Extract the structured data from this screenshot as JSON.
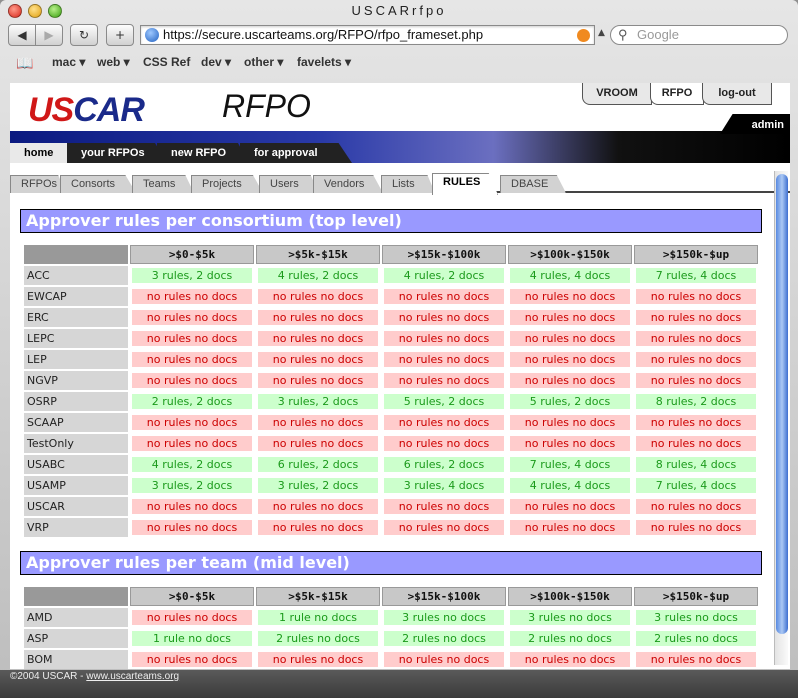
{
  "window": {
    "title": "USCARrfpo"
  },
  "browser": {
    "url": "https://secure.uscarteams.org/RFPO/rfpo_frameset.php",
    "search_placeholder": "Google",
    "bookmarks": [
      "mac ▾",
      "web ▾",
      "CSS Ref",
      "dev ▾",
      "other ▾",
      "favelets ▾"
    ]
  },
  "header": {
    "logo": "USCAR",
    "app": "RFPO",
    "user": "admin",
    "top_tabs": [
      "VROOM",
      "RFPO",
      "log-out"
    ]
  },
  "main_tabs": [
    "home",
    "your RFPOs",
    "new RFPO",
    "for approval"
  ],
  "sub_tabs": [
    "RFPOs",
    "Consorts",
    "Teams",
    "Projects",
    "Users",
    "Vendors",
    "Lists",
    "RULES",
    "DBASE"
  ],
  "columns": [
    ">$0-$5k",
    ">$5k-$15k",
    ">$15k-$100k",
    ">$100k-$150k",
    ">$150k-$up"
  ],
  "section1": {
    "title": "Approver rules per consortium (top level)",
    "rows": [
      {
        "name": "ACC",
        "cells": [
          "3 rules, 2 docs",
          "4 rules, 2 docs",
          "4 rules, 2 docs",
          "4 rules, 4 docs",
          "7 rules, 4 docs"
        ]
      },
      {
        "name": "EWCAP",
        "cells": [
          "no rules no docs",
          "no rules no docs",
          "no rules no docs",
          "no rules no docs",
          "no rules no docs"
        ]
      },
      {
        "name": "ERC",
        "cells": [
          "no rules no docs",
          "no rules no docs",
          "no rules no docs",
          "no rules no docs",
          "no rules no docs"
        ]
      },
      {
        "name": "LEPC",
        "cells": [
          "no rules no docs",
          "no rules no docs",
          "no rules no docs",
          "no rules no docs",
          "no rules no docs"
        ]
      },
      {
        "name": "LEP",
        "cells": [
          "no rules no docs",
          "no rules no docs",
          "no rules no docs",
          "no rules no docs",
          "no rules no docs"
        ]
      },
      {
        "name": "NGVP",
        "cells": [
          "no rules no docs",
          "no rules no docs",
          "no rules no docs",
          "no rules no docs",
          "no rules no docs"
        ]
      },
      {
        "name": "OSRP",
        "cells": [
          "2 rules, 2 docs",
          "3 rules, 2 docs",
          "5 rules, 2 docs",
          "5 rules, 2 docs",
          "8 rules, 2 docs"
        ]
      },
      {
        "name": "SCAAP",
        "cells": [
          "no rules no docs",
          "no rules no docs",
          "no rules no docs",
          "no rules no docs",
          "no rules no docs"
        ]
      },
      {
        "name": "TestOnly",
        "cells": [
          "no rules no docs",
          "no rules no docs",
          "no rules no docs",
          "no rules no docs",
          "no rules no docs"
        ]
      },
      {
        "name": "USABC",
        "cells": [
          "4 rules, 2 docs",
          "6 rules, 2 docs",
          "6 rules, 2 docs",
          "7 rules, 4 docs",
          "8 rules, 4 docs"
        ]
      },
      {
        "name": "USAMP",
        "cells": [
          "3 rules, 2 docs",
          "3 rules, 2 docs",
          "3 rules, 4 docs",
          "4 rules, 4 docs",
          "7 rules, 4 docs"
        ]
      },
      {
        "name": "USCAR",
        "cells": [
          "no rules no docs",
          "no rules no docs",
          "no rules no docs",
          "no rules no docs",
          "no rules no docs"
        ]
      },
      {
        "name": "VRP",
        "cells": [
          "no rules no docs",
          "no rules no docs",
          "no rules no docs",
          "no rules no docs",
          "no rules no docs"
        ]
      }
    ]
  },
  "section2": {
    "title": "Approver rules per team (mid level)",
    "rows": [
      {
        "name": "AMD",
        "cells": [
          "no rules no docs",
          "1 rule no docs",
          "3 rules no docs",
          "3 rules no docs",
          "3 rules no docs"
        ]
      },
      {
        "name": "ASP",
        "cells": [
          "1 rule no docs",
          "2 rules no docs",
          "2 rules no docs",
          "2 rules no docs",
          "2 rules no docs"
        ]
      },
      {
        "name": "BOM",
        "cells": [
          "no rules no docs",
          "no rules no docs",
          "no rules no docs",
          "no rules no docs",
          "no rules no docs"
        ]
      }
    ]
  },
  "status": {
    "copyright": "©2004 USCAR - ",
    "link": "www.uscarteams.org"
  },
  "colors": {
    "section_bg": "#9999ff",
    "ok_bg": "#ccffcc",
    "ok_text": "#1a9a1a",
    "none_bg": "#ffcccc",
    "none_text": "#cc0000"
  }
}
